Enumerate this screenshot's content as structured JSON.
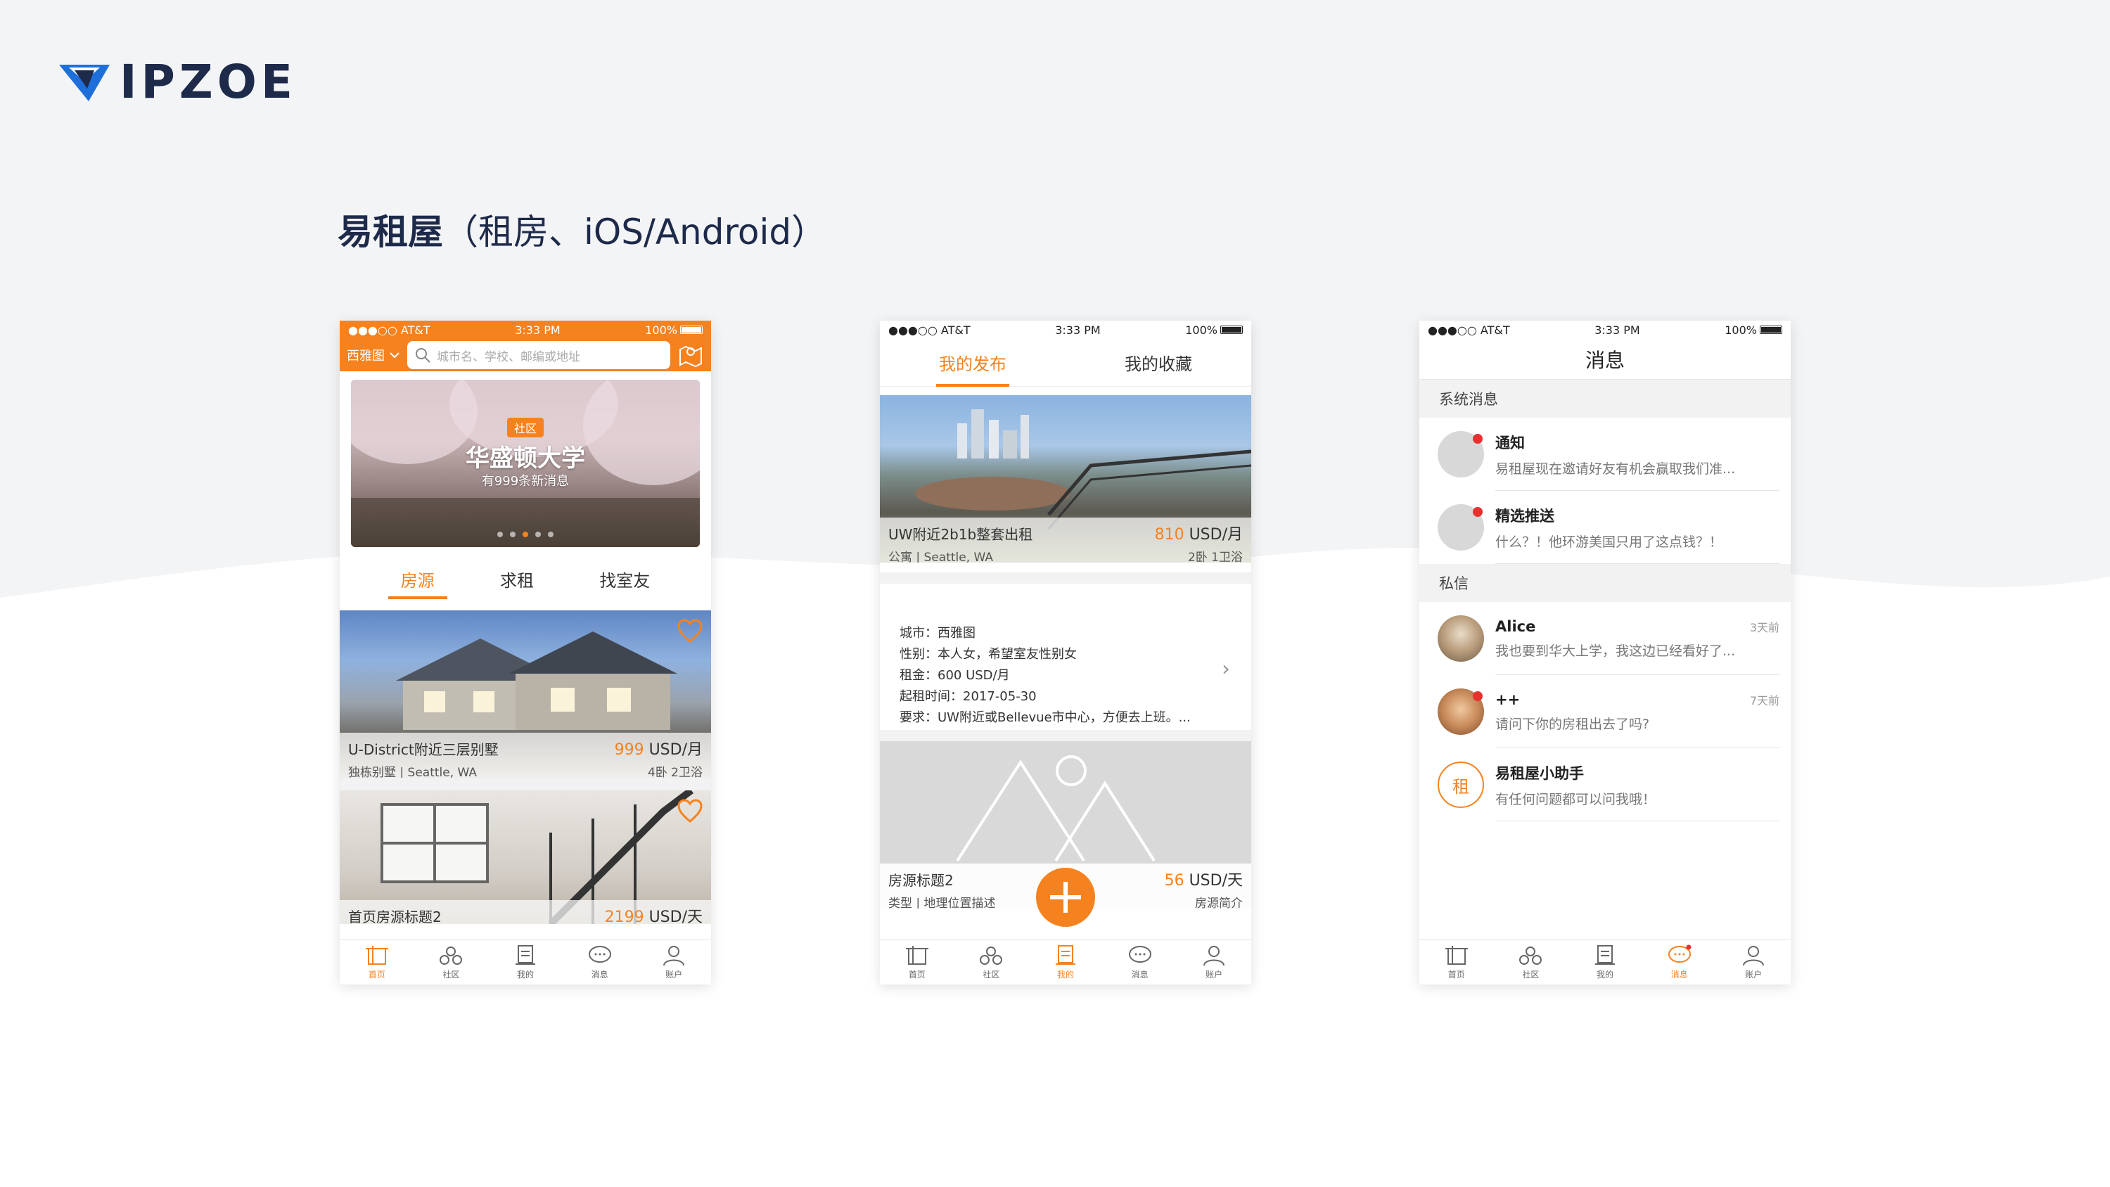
{
  "brand": {
    "name": "IPZOE"
  },
  "title": {
    "main": "易租屋",
    "suffix": "（租房、iOS/Android）"
  },
  "status": {
    "carrier": "●●●○○ AT&T",
    "time": "3:33 PM",
    "battery": "100%"
  },
  "colors": {
    "accent": "#f5821f",
    "navy": "#1e2a4a"
  },
  "phone1": {
    "city": "西雅图",
    "search_placeholder": "城市名、学校、邮编或地址",
    "banner": {
      "tag": "社区",
      "title": "华盛顿大学",
      "subtitle": "有999条新消息"
    },
    "tabs": [
      "房源",
      "求租",
      "找室友"
    ],
    "listings": [
      {
        "title": "U-District附近三层别墅",
        "price": "999",
        "unit": " USD/月",
        "type": "独栋别墅 | Seattle, WA",
        "rooms": "4卧 2卫浴"
      },
      {
        "title": "首页房源标题2",
        "price": "2199",
        "unit": " USD/天",
        "type": "",
        "rooms": ""
      }
    ]
  },
  "phone2": {
    "tabs": [
      "我的发布",
      "我的收藏"
    ],
    "listing1": {
      "title": "UW附近2b1b整套出租",
      "price": "810",
      "unit": " USD/月",
      "type": "公寓 | Seattle, WA",
      "rooms": "2卧 1卫浴"
    },
    "request": {
      "city": "城市：西雅图",
      "gender": "性别：本人女，希望室友性别女",
      "rent": "租金：600 USD/月",
      "date": "起租时间：2017-05-30",
      "req": "要求：UW附近或Bellevue市中心，方便去上班。..."
    },
    "listing2": {
      "title": "房源标题2",
      "price": "56",
      "unit": " USD/天",
      "type": "类型 | 地理位置描述",
      "rooms": "房源简介"
    }
  },
  "phone3": {
    "title": "消息",
    "sys_label": "系统消息",
    "sys": [
      {
        "name": "通知",
        "text": "易租屋现在邀请好友有机会赢取我们准..."
      },
      {
        "name": "精选推送",
        "text": "什么？！他环游美国只用了这点钱？！"
      }
    ],
    "pm_label": "私信",
    "pm": [
      {
        "name": "Alice",
        "time": "3天前",
        "text": "我也要到华大上学，我这边已经看好了..."
      },
      {
        "name": "++",
        "time": "7天前",
        "text": "请问下你的房租出去了吗?"
      },
      {
        "name": "易租屋小助手",
        "time": "",
        "text": "有任何问题都可以问我哦！"
      }
    ],
    "helper_badge": "租"
  },
  "tabbar": [
    "首页",
    "社区",
    "我的",
    "消息",
    "账户"
  ]
}
